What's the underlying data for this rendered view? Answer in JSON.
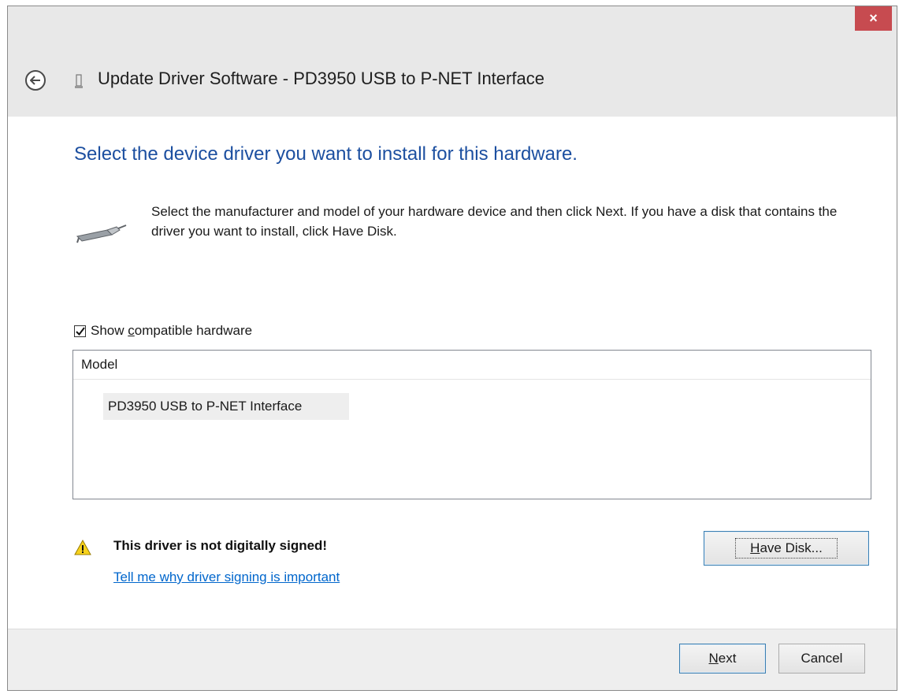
{
  "window": {
    "title": "Update Driver Software - PD3950 USB to P-NET Interface",
    "close_label": "×"
  },
  "main": {
    "heading": "Select the device driver you want to install for this hardware.",
    "instruction": "Select the manufacturer and model of your hardware device and then click Next. If you have a disk that contains the driver you want to install, click Have Disk.",
    "show_compatible": {
      "label_pre": "Show ",
      "label_accel": "c",
      "label_post": "ompatible hardware",
      "checked": true
    },
    "model_list": {
      "header": "Model",
      "items": [
        "PD3950 USB to P-NET Interface"
      ]
    },
    "warning": {
      "text": "This driver is not digitally signed!",
      "link": "Tell me why driver signing is important"
    },
    "have_disk": {
      "accel": "H",
      "rest": "ave Disk..."
    }
  },
  "footer": {
    "next": {
      "accel": "N",
      "rest": "ext"
    },
    "cancel": "Cancel"
  },
  "colors": {
    "heading": "#1c4fa0",
    "link": "#0066cc",
    "close": "#c74b50"
  },
  "icons": {
    "back": "back-arrow-icon",
    "device": "serial-cable-icon",
    "warning": "warning-triangle-icon"
  }
}
